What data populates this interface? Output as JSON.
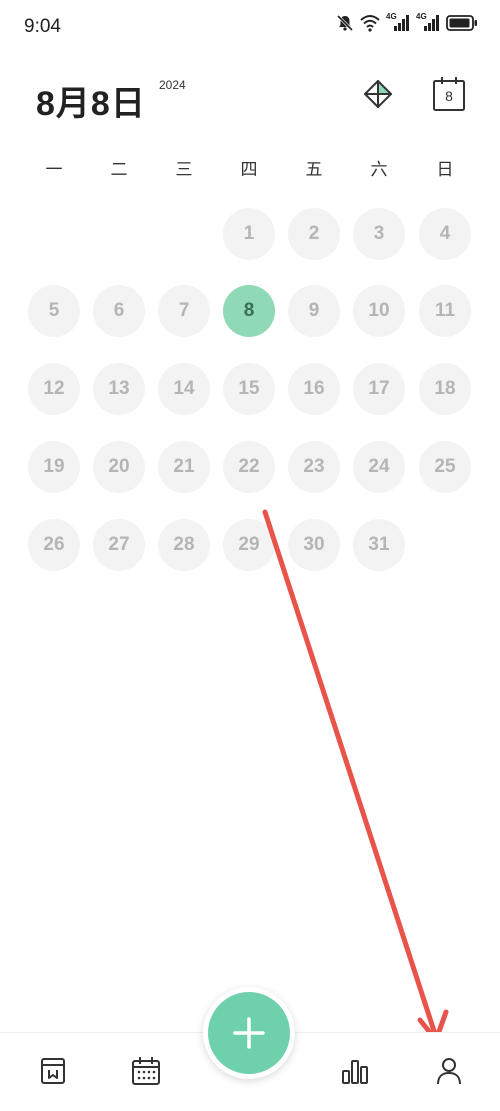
{
  "status_bar": {
    "time": "9:04",
    "signal1_label": "4G",
    "signal2_label": "4G"
  },
  "header": {
    "date_title": "8月8日",
    "year": "2024",
    "today_button_day": "8"
  },
  "weekdays": [
    "一",
    "二",
    "三",
    "四",
    "五",
    "六",
    "日"
  ],
  "calendar": {
    "first_weekday_index": 3,
    "days_in_month": 31,
    "selected_day": 8
  },
  "colors": {
    "accent": "#6fd1ab",
    "selected_day_bg": "#8fd9b6",
    "day_bg": "#f3f3f3",
    "annotation_arrow": "#e8534a"
  },
  "bottom_nav": {
    "icons": [
      "notebook-icon",
      "calendar-icon",
      "add-icon",
      "bar-chart-icon",
      "profile-icon"
    ]
  }
}
